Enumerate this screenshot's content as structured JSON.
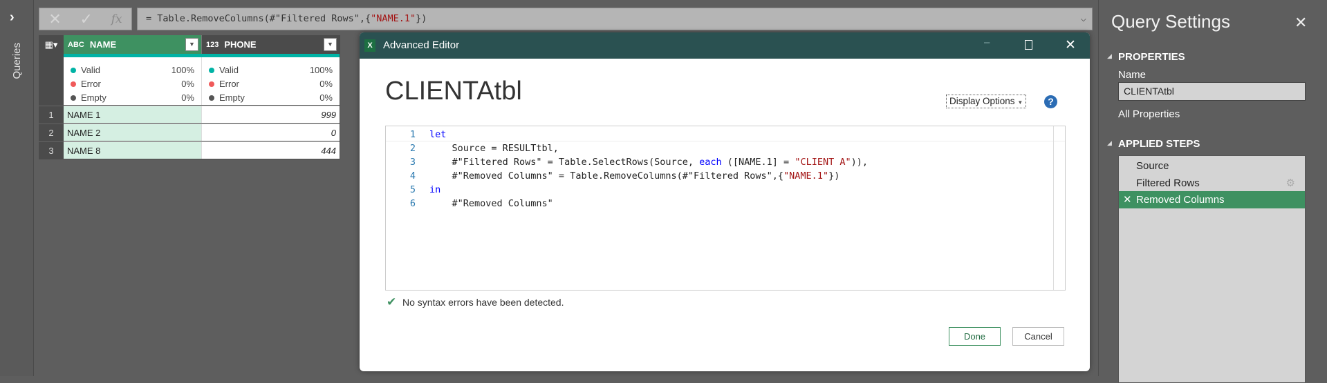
{
  "queries_pane": {
    "label": "Queries"
  },
  "formula_bar": {
    "prefix": "= Table.RemoveColumns(#\"Filtered Rows\",{",
    "string": "\"NAME.1\"",
    "suffix": "})",
    "fx": "fx"
  },
  "grid": {
    "columns": [
      {
        "type_icon": "ABC",
        "name": "NAME"
      },
      {
        "type_icon": "123",
        "name": "PHONE"
      }
    ],
    "stats": [
      {
        "label": "Valid",
        "value": "100%",
        "color": "#00b3a5"
      },
      {
        "label": "Error",
        "value": "0%",
        "color": "#f05a5a"
      },
      {
        "label": "Empty",
        "value": "0%",
        "color": "#555555"
      }
    ],
    "rows": [
      {
        "n": "1",
        "name": "NAME 1",
        "phone": "999"
      },
      {
        "n": "2",
        "name": "NAME 2",
        "phone": "0"
      },
      {
        "n": "3",
        "name": "NAME 8",
        "phone": "444"
      }
    ]
  },
  "dialog": {
    "title": "Advanced Editor",
    "query_name": "CLIENTAtbl",
    "display_options": "Display Options",
    "status": "No syntax errors have been detected.",
    "done": "Done",
    "cancel": "Cancel",
    "code_lines": [
      "1",
      "2",
      "3",
      "4",
      "5",
      "6"
    ]
  },
  "settings": {
    "title": "Query Settings",
    "properties": "PROPERTIES",
    "name_label": "Name",
    "name_value": "CLIENTAtbl",
    "all_properties": "All Properties",
    "applied_steps": "APPLIED STEPS",
    "steps": [
      "Source",
      "Filtered Rows",
      "Removed Columns"
    ]
  },
  "colors": {
    "accent_green": "#3e9161",
    "teal": "#00b3a5",
    "dialog_header": "#2a5151"
  }
}
